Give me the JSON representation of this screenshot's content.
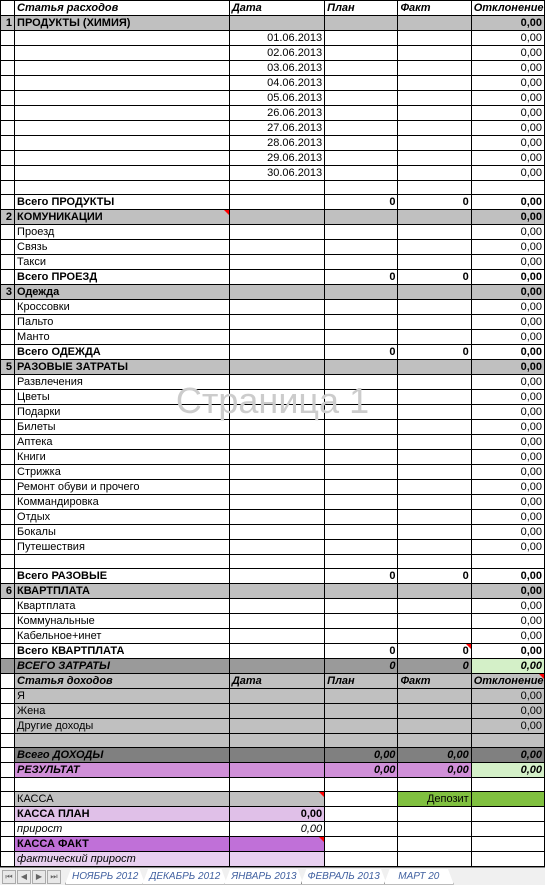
{
  "watermark": "Страница 1",
  "headers": {
    "item": "Статья расходов",
    "date": "Дата",
    "plan": "План",
    "fact": "Факт",
    "dev": "Отклонение"
  },
  "sections": [
    {
      "num": "1",
      "title": "ПРОДУКТЫ (ХИМИЯ)",
      "dev": "0,00",
      "rows": [
        {
          "date": "01.06.2013",
          "dev": "0,00"
        },
        {
          "date": "02.06.2013",
          "dev": "0,00"
        },
        {
          "date": "03.06.2013",
          "dev": "0,00"
        },
        {
          "date": "04.06.2013",
          "dev": "0,00"
        },
        {
          "date": "05.06.2013",
          "dev": "0,00"
        },
        {
          "date": "26.06.2013",
          "dev": "0,00"
        },
        {
          "date": "27.06.2013",
          "dev": "0,00"
        },
        {
          "date": "28.06.2013",
          "dev": "0,00"
        },
        {
          "date": "29.06.2013",
          "dev": "0,00"
        },
        {
          "date": "30.06.2013",
          "dev": "0,00"
        }
      ],
      "blank_after": 1,
      "total": {
        "label": "Всего ПРОДУКТЫ",
        "plan": "0",
        "fact": "0",
        "dev": "0,00"
      }
    },
    {
      "num": "2",
      "title": "КОМУНИКАЦИИ",
      "dev": "0,00",
      "rows": [
        {
          "item": "Проезд",
          "dev": "0,00"
        },
        {
          "item": "Связь",
          "dev": "0,00"
        },
        {
          "item": "Такси",
          "dev": "0,00"
        }
      ],
      "total": {
        "label": "Всего ПРОЕЗД",
        "plan": "0",
        "fact": "0",
        "dev": "0,00"
      }
    },
    {
      "num": "3",
      "title": "Одежда",
      "dev": "0,00",
      "rows": [
        {
          "item": "Кроссовки",
          "dev": "0,00"
        },
        {
          "item": "Пальто",
          "dev": "0,00"
        },
        {
          "item": "Манто",
          "dev": "0,00"
        }
      ],
      "total": {
        "label": "Всего ОДЕЖДА",
        "plan": "0",
        "fact": "0",
        "dev": "0,00"
      }
    },
    {
      "num": "5",
      "title": "РАЗОВЫЕ ЗАТРАТЫ",
      "dev": "0,00",
      "rows": [
        {
          "item": "Развлечения",
          "dev": "0,00"
        },
        {
          "item": "Цветы",
          "dev": "0,00"
        },
        {
          "item": "Подарки",
          "dev": "0,00"
        },
        {
          "item": "Билеты",
          "dev": "0,00"
        },
        {
          "item": "Аптека",
          "dev": "0,00"
        },
        {
          "item": "Книги",
          "dev": "0,00"
        },
        {
          "item": "Стрижка",
          "dev": "0,00"
        },
        {
          "item": "Ремонт обуви и прочего",
          "dev": "0,00"
        },
        {
          "item": "Коммандировка",
          "dev": "0,00"
        },
        {
          "item": "Отдых",
          "dev": "0,00"
        },
        {
          "item": "Бокалы",
          "dev": "0,00"
        },
        {
          "item": "Путешествия",
          "dev": "0,00"
        }
      ],
      "blank_after": 1,
      "total": {
        "label": "Всего РАЗОВЫЕ",
        "plan": "0",
        "fact": "0",
        "dev": "0,00"
      }
    },
    {
      "num": "6",
      "title": "КВАРТПЛАТА",
      "dev": "0,00",
      "rows": [
        {
          "item": "Квартплата",
          "dev": "0,00"
        },
        {
          "item": "Коммунальные",
          "dev": "0,00"
        },
        {
          "item": "Кабельное+инет",
          "dev": "0,00"
        }
      ],
      "total": {
        "label": "Всего КВАРТПЛАТА",
        "plan": "0",
        "fact": "0",
        "dev": "0,00",
        "green_fact": true
      }
    }
  ],
  "grand_total": {
    "label": "ВСЕГО ЗАТРАТЫ",
    "plan": "0",
    "fact": "0",
    "dev": "0,00"
  },
  "income_header": {
    "item": "Статья доходов",
    "date": "Дата",
    "plan": "План",
    "fact": "Факт",
    "dev": "Отклонение"
  },
  "income_rows": [
    {
      "item": "Я",
      "dev": "0,00"
    },
    {
      "item": "Жена",
      "dev": "0,00"
    },
    {
      "item": "Другие доходы",
      "dev": "0,00"
    }
  ],
  "income_total": {
    "label": "Всего ДОХОДЫ",
    "plan": "0,00",
    "fact": "0,00",
    "dev": "0,00"
  },
  "result": {
    "label": "РЕЗУЛЬТАТ",
    "plan": "0,00",
    "fact": "0,00",
    "dev": "0,00"
  },
  "kassa": {
    "header": "КАССА",
    "deposit": "Депозит",
    "plan_label": "КАССА ПЛАН",
    "plan_value": "0,00",
    "prirost_label": "прирост",
    "prirost_value": "0,00",
    "fakt_label": "КАССА ФАКТ",
    "fprirost_label": "фактический прирост"
  },
  "tabs": [
    "НОЯБРЬ 2012",
    "ДЕКАБРЬ 2012",
    "ЯНВАРЬ 2013",
    "ФЕВРАЛЬ 2013",
    "МАРТ 20"
  ]
}
